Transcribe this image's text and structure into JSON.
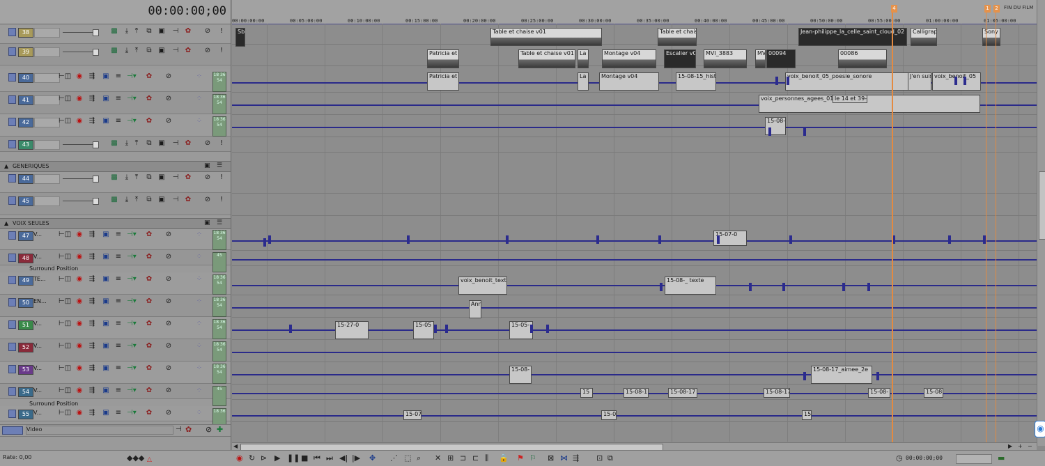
{
  "timecode": "00:00:00;00",
  "colors": {
    "envelope": "#2a2a8a",
    "marker": "#e38a41",
    "track_header": "#9c9c9c",
    "timeline_bg": "#8d8d8d"
  },
  "ruler_ticks": [
    "00:00:00:00",
    "00:05:00:00",
    "00:10:00:00",
    "00:15:00:00",
    "00:20:00:00",
    "00:25:00:00",
    "00:30:00:00",
    "00:35:00:00",
    "00:40:00:00",
    "00:45:00:00",
    "00:50:00:00",
    "00:55:00:00",
    "01:00:00:00",
    "01:05:00:00"
  ],
  "markers": {
    "m1": "4",
    "m2": "1",
    "m3": "2",
    "end_label": "FIN DU FILM"
  },
  "groups": {
    "generiques": "GENERIQUES",
    "voix_seules": "VOIX SEULES"
  },
  "tracks": [
    {
      "num": "38",
      "name": "",
      "color": "#a89a5a",
      "kind": "video",
      "meter": ""
    },
    {
      "num": "39",
      "name": "",
      "color": "#a89a5a",
      "kind": "video",
      "meter": ""
    },
    {
      "num": "40",
      "name": "",
      "color": "#4a6a9a",
      "kind": "audio",
      "meter": "18\n36\n54"
    },
    {
      "num": "41",
      "name": "",
      "color": "#4a6a9a",
      "kind": "audio",
      "meter": "18\n36\n54"
    },
    {
      "num": "42",
      "name": "",
      "color": "#4a6a9a",
      "kind": "audio",
      "meter": "18\n36\n54"
    },
    {
      "num": "43",
      "name": "",
      "color": "#3a8a6a",
      "kind": "video",
      "meter": ""
    },
    {
      "num": "44",
      "name": "",
      "color": "#4a6a9a",
      "kind": "video",
      "meter": ""
    },
    {
      "num": "45",
      "name": "",
      "color": "#4a6a9a",
      "kind": "video",
      "meter": ""
    },
    {
      "num": "47",
      "name": "V...",
      "color": "#4a6a9a",
      "kind": "audio",
      "meter": "18\n36\n54"
    },
    {
      "num": "48",
      "name": "V...",
      "color": "#8a2a3a",
      "kind": "audio",
      "meter": "45"
    },
    {
      "num": "49",
      "name": "TE...",
      "color": "#4a6a9a",
      "kind": "audio",
      "meter": "18\n36\n54"
    },
    {
      "num": "50",
      "name": "EN...",
      "color": "#4a6a9a",
      "kind": "audio",
      "meter": "18\n36\n54"
    },
    {
      "num": "51",
      "name": "V...",
      "color": "#3a8a4a",
      "kind": "audio",
      "meter": "18\n36\n54"
    },
    {
      "num": "52",
      "name": "V...",
      "color": "#8a2a3a",
      "kind": "audio",
      "meter": "18\n36\n54"
    },
    {
      "num": "53",
      "name": "V...",
      "color": "#6a3a8a",
      "kind": "audio",
      "meter": "18\n36\n54"
    },
    {
      "num": "54",
      "name": "V...",
      "color": "#3a6a8a",
      "kind": "audio",
      "meter": "45"
    },
    {
      "num": "55",
      "name": "V...",
      "color": "#3a6a8a",
      "kind": "audio",
      "meter": "18\n36"
    }
  ],
  "surround_label_1": "Surround Position",
  "surround_label_2": "Surround Position",
  "video_bus": "Video",
  "rate": "Rate: 0,00",
  "bottom_timecode": "00:00:00;00",
  "clips": {
    "c1": "Sb",
    "c2": "Table et chaise v01",
    "c3": "Table et chais",
    "c4": "Jean-philippe_la_celle_saint_cloud_02",
    "c5": "Calligraphi",
    "c6": "Sony",
    "c7": "Patricia et",
    "c8": "Table et chaise v01",
    "c9": "La",
    "c10": "Montage v04",
    "c11": "Escalier v02",
    "c12": "MVI_3883",
    "c13": "MV",
    "c14": "00094",
    "c15": "00086",
    "c16": "Patricia et",
    "c17": "La m",
    "c18": "Montage v04",
    "c19": "15-08-15_hist",
    "c20": "voix_benoit_05_poesie_sonore",
    "c21": "J'en suis l",
    "c22": "voix_benoit_05",
    "c23": "voix_personnes_agees_01",
    "c24": "le 14 et 39-45",
    "c25": "15-08-1",
    "c26": "15-07-0",
    "c27": "voix_benoit_texte",
    "c28": "15-08-_ texte",
    "c29": "Ann",
    "c30": "15-27-0",
    "c31": "15-05",
    "c32": "15-05-",
    "c33": "15-08-",
    "c34": "15-08-17_aimee_2e",
    "c35": "15",
    "c36": "15-08-1",
    "c37": "15-08-17",
    "c38": "15-08-17",
    "c39": "15-08-",
    "c40": "15-08",
    "c41": "15-07",
    "c42": "15-0",
    "c43": "15"
  }
}
